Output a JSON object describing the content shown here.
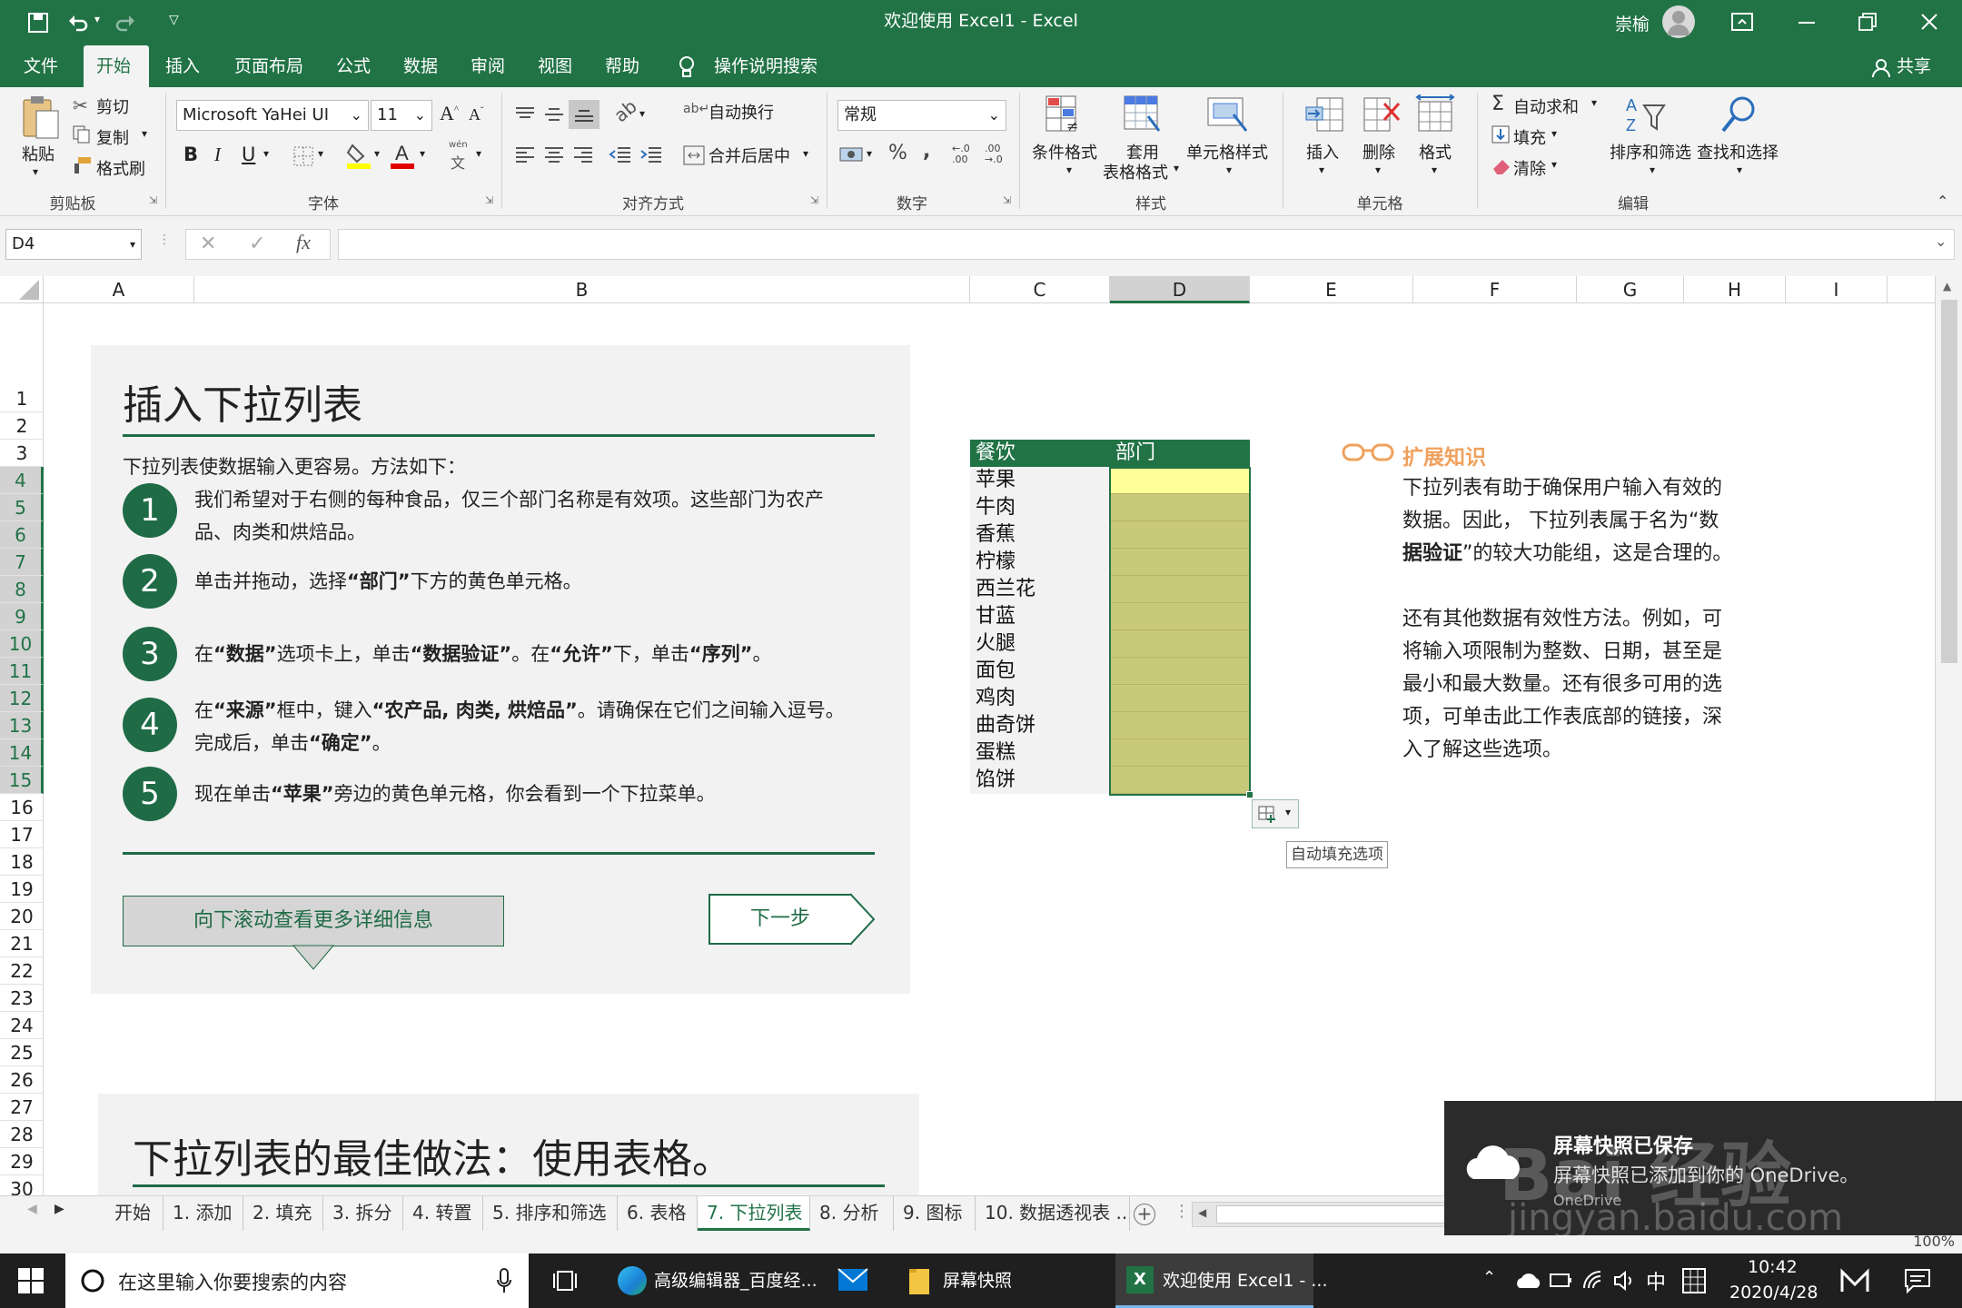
{
  "window": {
    "title": "欢迎使用 Excel1  -  Excel",
    "user": "崇榆",
    "qat_icons": [
      "save-icon",
      "undo-icon",
      "redo-icon",
      "customize-icon"
    ]
  },
  "ribbon_tabs": [
    "文件",
    "开始",
    "插入",
    "页面布局",
    "公式",
    "数据",
    "审阅",
    "视图",
    "帮助"
  ],
  "tell_me": "操作说明搜索",
  "share": "共享",
  "clipboard": {
    "paste": "粘贴",
    "cut": "剪切",
    "copy": "复制",
    "format_painter": "格式刷",
    "label": "剪贴板"
  },
  "font": {
    "name": "Microsoft YaHei UI",
    "size": "11",
    "bold": "B",
    "italic": "I",
    "underline": "U",
    "phonetic": "wén",
    "phonetic_char": "文",
    "label": "字体"
  },
  "alignment": {
    "wrap": "自动换行",
    "merge": "合并后居中",
    "label": "对齐方式"
  },
  "number": {
    "format": "常规",
    "percent": "%",
    "comma": ",",
    "label": "数字"
  },
  "styles": {
    "conditional": "条件格式",
    "table_a": "套用",
    "table_b": "表格格式",
    "cell_styles": "单元格样式",
    "label": "样式"
  },
  "cells": {
    "insert": "插入",
    "delete": "删除",
    "format": "格式",
    "label": "单元格"
  },
  "editing": {
    "autosum": "自动求和",
    "fill": "填充",
    "clear": "清除",
    "sort": "排序和筛选",
    "find": "查找和选择",
    "label": "编辑"
  },
  "formula_bar": {
    "name_box": "D4",
    "fx": "fx",
    "value": ""
  },
  "columns": [
    "A",
    "B",
    "C",
    "D",
    "E",
    "F",
    "G",
    "H",
    "I"
  ],
  "rows": [
    "1",
    "2",
    "3",
    "4",
    "5",
    "6",
    "7",
    "8",
    "9",
    "10",
    "11",
    "12",
    "13",
    "14",
    "15",
    "16",
    "17",
    "18",
    "19",
    "20",
    "21",
    "22",
    "23",
    "24",
    "25",
    "26",
    "27",
    "28",
    "29",
    "30"
  ],
  "panel": {
    "title": "插入下拉列表",
    "intro": "下拉列表使数据输入更容易。方法如下：",
    "steps": [
      {
        "num": "1",
        "text": "我们希望对于右侧的每种食品，仅三个部门名称是有效项。这些部门为农产",
        "text2": "品、肉类和烘焙品。"
      },
      {
        "num": "2",
        "pre": "单击并拖动，选择",
        "b1": "“部门”",
        "post": "下方的黄色单元格。"
      },
      {
        "num": "3",
        "pre": "在",
        "b1": "“数据”",
        "mid1": "选项卡上，单击",
        "b2": "“数据验证”",
        "mid2": "。在",
        "b3": "“允许”",
        "mid3": "下，单击",
        "b4": "“序列”",
        "post": "。"
      },
      {
        "num": "4",
        "pre": "在",
        "b1": "“来源”",
        "mid1": "框中，键入",
        "b2": "“农产品, 肉类, 烘焙品”",
        "post": "。请确保在它们之间输入逗号。",
        "line2_pre": "完成后，单击",
        "line2_b": "“确定”",
        "line2_post": "。"
      },
      {
        "num": "5",
        "pre": "现在单击",
        "b1": "“苹果”",
        "post": "旁边的黄色单元格，你会看到一个下拉菜单。"
      }
    ],
    "scroll_btn": "向下滚动查看更多详细信息",
    "next_btn": "下一步"
  },
  "panel2": {
    "title": "下拉列表的最佳做法：使用表格。"
  },
  "table": {
    "headers": [
      "餐饮",
      "部门"
    ],
    "items": [
      "苹果",
      "牛肉",
      "香蕉",
      "柠檬",
      "西兰花",
      "甘蓝",
      "火腿",
      "面包",
      "鸡肉",
      "曲奇饼",
      "蛋糕",
      "馅饼"
    ]
  },
  "autofill_tooltip": "自动填充选项",
  "tips": {
    "title": "扩展知识",
    "p1_lines": [
      "下拉列表有助于确保用户输入有效的",
      "数据。因此， 下拉列表属于名为“数"
    ],
    "p1_bold": "据验证",
    "p1_tail": "”的较大功能组，这是合理的。",
    "p2_lines": [
      "还有其他数据有效性方法。例如，可",
      "将输入项限制为整数、日期，甚至是",
      "最小和最大数量。还有很多可用的选",
      "项，可单击此工作表底部的链接，深",
      "入了解这些选项。"
    ]
  },
  "sheet_tabs": [
    "开始",
    "1. 添加",
    "2. 填充",
    "3. 拆分",
    "4. 转置",
    "5. 排序和筛选",
    "6. 表格",
    "7. 下拉列表",
    "8. 分析",
    "9. 图标",
    "10. 数据透视表 ..."
  ],
  "active_sheet": "7. 下拉列表",
  "zoom": "100%",
  "notification": {
    "title": "屏幕快照已保存",
    "body": "屏幕快照已添加到你的 OneDrive。",
    "source": "OneDrive"
  },
  "watermark": {
    "brand": "Bai 经验",
    "url": "jingyan.baidu.com"
  },
  "taskbar": {
    "search": "在这里输入你要搜索的内容",
    "apps": [
      "高级编辑器_百度经...",
      "屏幕快照",
      "欢迎使用 Excel1 - ..."
    ],
    "ime": "中",
    "time": "10:42",
    "date": "2020/4/28"
  }
}
